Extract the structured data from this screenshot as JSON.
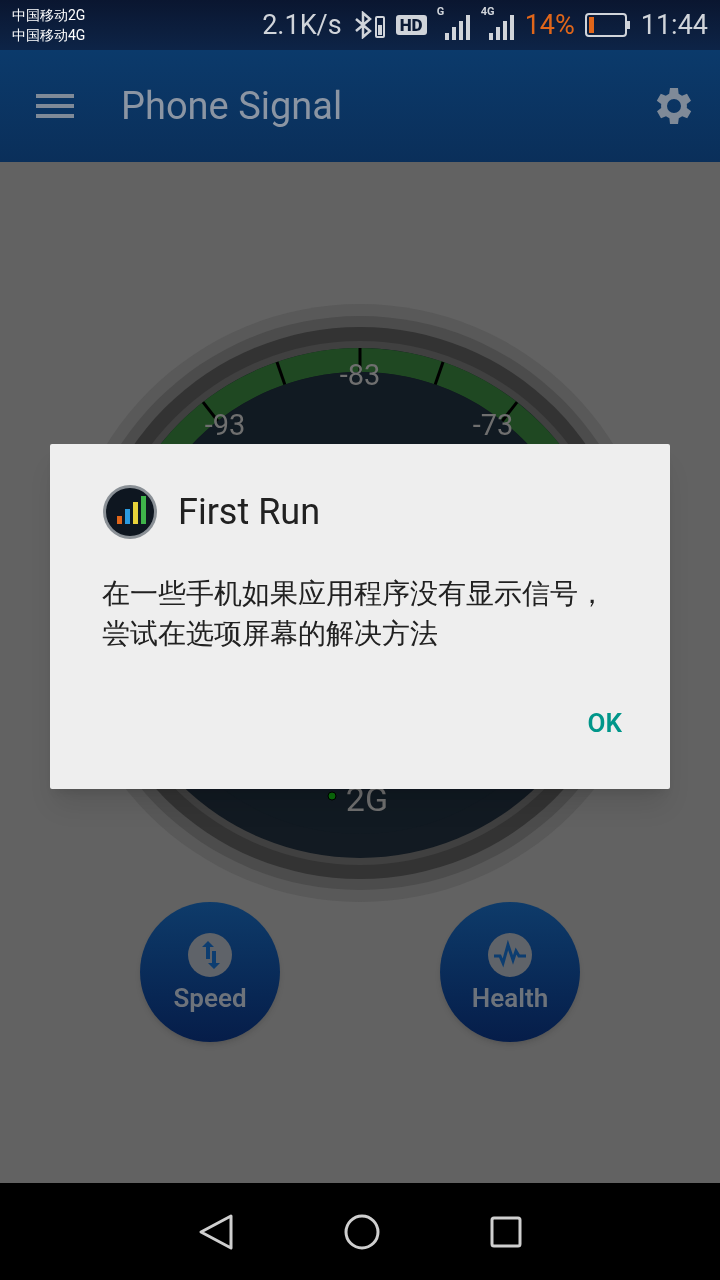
{
  "status_bar": {
    "carriers": [
      "中国移动2G",
      "中国移动4G"
    ],
    "speed": "2.1K/s",
    "hd": "HD",
    "network_labels": [
      "G",
      "4G"
    ],
    "battery_percent": "14%",
    "time": "11:44"
  },
  "app_bar": {
    "title": "Phone Signal"
  },
  "gauge": {
    "labels": [
      "-93",
      "-83",
      "-73"
    ],
    "network": "2G"
  },
  "buttons": [
    {
      "label": "Speed",
      "kind": "speed"
    },
    {
      "label": "Health",
      "kind": "health"
    }
  ],
  "dialog": {
    "title": "First Run",
    "message": "在一些手机如果应用程序没有显示信号，尝试在选项屏幕的解决方法",
    "buttons": [
      "OK"
    ]
  }
}
